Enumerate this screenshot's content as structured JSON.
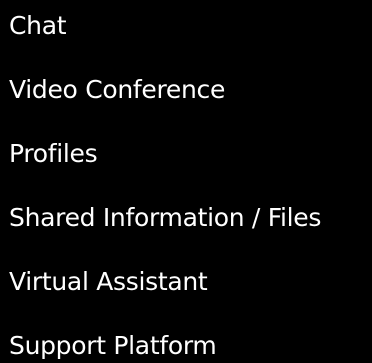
{
  "menu": {
    "items": [
      {
        "label": "Chat"
      },
      {
        "label": "Video Conference"
      },
      {
        "label": "Profiles"
      },
      {
        "label": "Shared Information / Files"
      },
      {
        "label": "Virtual Assistant"
      },
      {
        "label": "Support Platform"
      }
    ]
  },
  "colors": {
    "background": "#000000",
    "text": "#ffffff"
  }
}
